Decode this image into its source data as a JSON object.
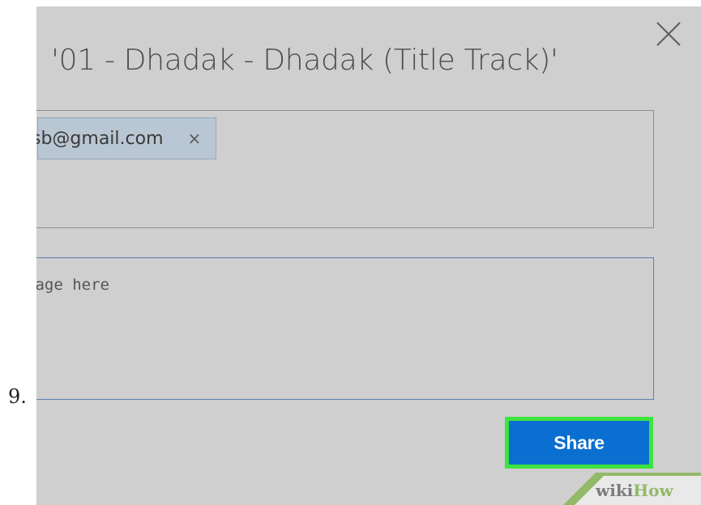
{
  "step": {
    "number": "9."
  },
  "dialog": {
    "title": "'01 - Dhadak - Dhadak (Title Track)'",
    "recipient_chip": {
      "email_visible": "sb@gmail.com",
      "remove_glyph": "×"
    },
    "message": {
      "placeholder_visible": "sage here"
    },
    "share_label": "Share",
    "icons": [
      "close-icon",
      "chip-remove-icon"
    ]
  },
  "watermark": {
    "part1": "wiki",
    "part2": "How"
  },
  "colors": {
    "background": "#cfcfcf",
    "share_button": "#0a6fd0",
    "highlight": "#3ee33e",
    "chip": "#b9c6d3",
    "message_border": "#5b7fb0"
  }
}
